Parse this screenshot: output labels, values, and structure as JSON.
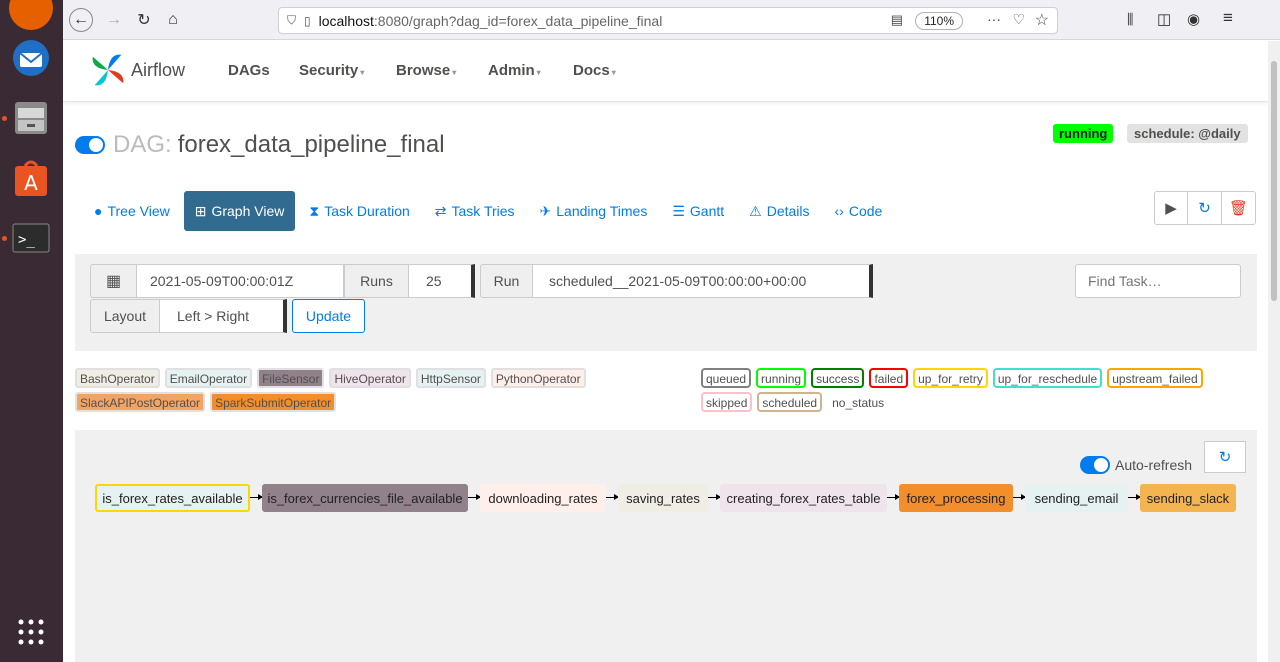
{
  "browser": {
    "url_host": "localhost",
    "url_rest": ":8080/graph?dag_id=forex_data_pipeline_final",
    "zoom": "110%"
  },
  "navbar": {
    "brand": "Airflow",
    "menus": [
      "DAGs",
      "Security",
      "Browse",
      "Admin",
      "Docs"
    ]
  },
  "dag": {
    "prefix": "DAG:",
    "name": "forex_data_pipeline_final",
    "state": "running",
    "schedule": "schedule: @daily"
  },
  "tabs": [
    "Tree View",
    "Graph View",
    "Task Duration",
    "Task Tries",
    "Landing Times",
    "Gantt",
    "Details",
    "Code"
  ],
  "controls": {
    "execution_date": "2021-05-09T00:00:01Z",
    "runs_label": "Runs",
    "runs_value": "25",
    "run_label": "Run",
    "run_value": "scheduled__2021-05-09T00:00:00+00:00",
    "find_task_placeholder": "Find Task…",
    "layout_label": "Layout",
    "layout_value": "Left > Right",
    "update_label": "Update"
  },
  "operators": [
    {
      "name": "BashOperator",
      "color": "#f0ede4"
    },
    {
      "name": "EmailOperator",
      "color": "#e6f1f2"
    },
    {
      "name": "FileSensor",
      "color": "#91818a"
    },
    {
      "name": "HiveOperator",
      "color": "#f0e4ec"
    },
    {
      "name": "HttpSensor",
      "color": "#e6f1f2"
    },
    {
      "name": "PythonOperator",
      "color": "#ffefeb"
    },
    {
      "name": "SlackAPIPostOperator",
      "color": "#f4a460"
    },
    {
      "name": "SparkSubmitOperator",
      "color": "#f28f2c"
    }
  ],
  "states": [
    {
      "name": "queued",
      "border": "#808080"
    },
    {
      "name": "running",
      "border": "#00ff00"
    },
    {
      "name": "success",
      "border": "#008000"
    },
    {
      "name": "failed",
      "border": "#ff0000"
    },
    {
      "name": "up_for_retry",
      "border": "#ffd700"
    },
    {
      "name": "up_for_reschedule",
      "border": "#40e0d0"
    },
    {
      "name": "upstream_failed",
      "border": "#ffa500"
    },
    {
      "name": "skipped",
      "border": "#ffc0cb"
    },
    {
      "name": "scheduled",
      "border": "#d2b48c"
    },
    {
      "name": "no_status",
      "border": "transparent"
    }
  ],
  "auto_refresh_label": "Auto-refresh",
  "tasks": [
    {
      "name": "is_forex_rates_available",
      "fill": "#e6f1f2",
      "border": "#ffd700"
    },
    {
      "name": "is_forex_currencies_file_available",
      "fill": "#91818a",
      "border": "#91818a"
    },
    {
      "name": "downloading_rates",
      "fill": "#ffefeb",
      "border": "#ffefeb"
    },
    {
      "name": "saving_rates",
      "fill": "#f0ede4",
      "border": "#f0ede4"
    },
    {
      "name": "creating_forex_rates_table",
      "fill": "#f0e4ec",
      "border": "#f0e4ec"
    },
    {
      "name": "forex_processing",
      "fill": "#f28f2c",
      "border": "#f28f2c"
    },
    {
      "name": "sending_email",
      "fill": "#e6f1f2",
      "border": "#e6f1f2"
    },
    {
      "name": "sending_slack",
      "fill": "#f4b450",
      "border": "#f4b450"
    }
  ]
}
